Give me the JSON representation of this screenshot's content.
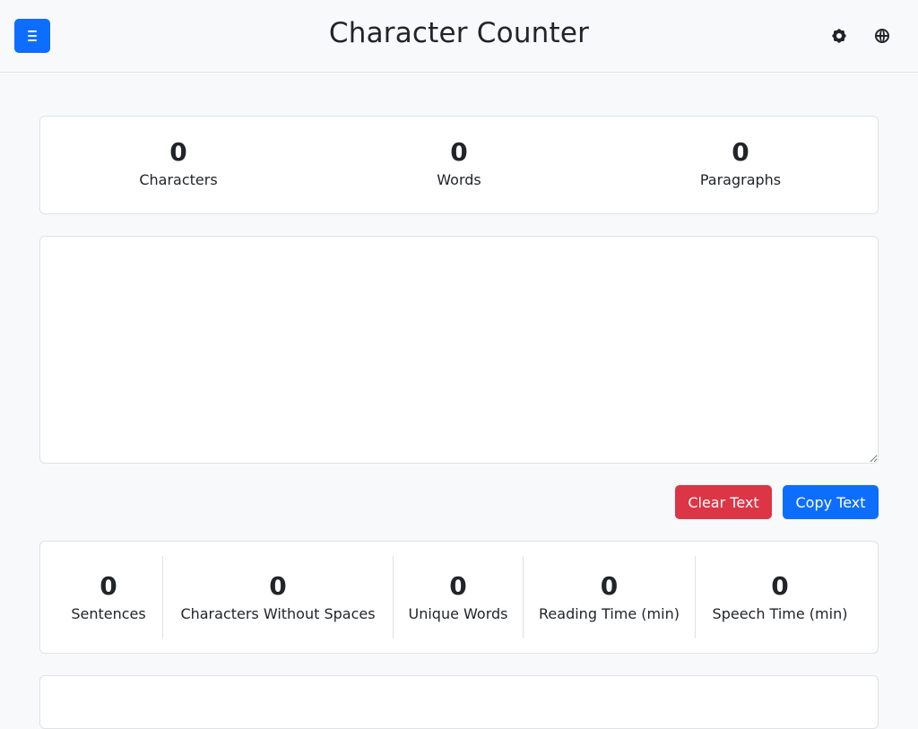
{
  "header": {
    "title": "Character Counter",
    "menu_icon": "hamburger-menu-icon",
    "settings_icon": "gear-icon",
    "language_icon": "globe-icon",
    "accent_color": "#0d6efd"
  },
  "top_stats": [
    {
      "value": "0",
      "label": "Characters"
    },
    {
      "value": "0",
      "label": "Words"
    },
    {
      "value": "0",
      "label": "Paragraphs"
    }
  ],
  "editor": {
    "value": "",
    "placeholder": ""
  },
  "actions": {
    "clear_label": "Clear Text",
    "clear_color": "#dc3545",
    "copy_label": "Copy Text",
    "copy_color": "#0d6efd"
  },
  "bottom_stats": [
    {
      "value": "0",
      "label": "Sentences"
    },
    {
      "value": "0",
      "label": "Characters Without Spaces"
    },
    {
      "value": "0",
      "label": "Unique Words"
    },
    {
      "value": "0",
      "label": "Reading Time (min)"
    },
    {
      "value": "0",
      "label": "Speech Time (min)"
    }
  ]
}
